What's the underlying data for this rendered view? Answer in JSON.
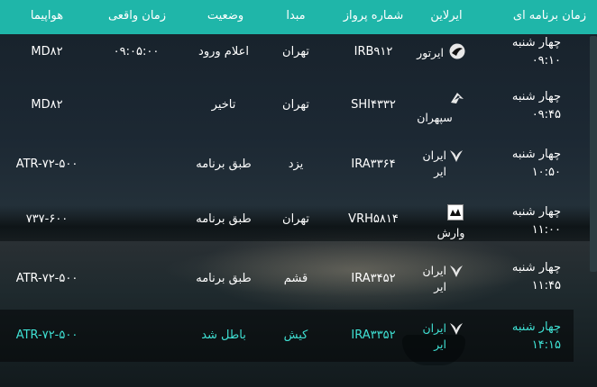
{
  "header": {
    "scheduled": "زمان برنامه ای",
    "airline": "ایرلاین",
    "flight_no": "شماره پرواز",
    "origin": "مبدا",
    "status": "وضعیت",
    "actual_time": "زمان واقعی",
    "aircraft": "هواپیما"
  },
  "flights": [
    {
      "day": "چهار شنبه",
      "time": "۰۹:۱۰",
      "airline": "ایرتور",
      "logo": "airtour-logo",
      "flight": "IRB۹۱۲",
      "origin": "تهران",
      "status": "اعلام ورود",
      "actual": "۰۹:۰۵:۰۰",
      "aircraft": "MD۸۲"
    },
    {
      "day": "چهار شنبه",
      "time": "۰۹:۴۵",
      "airline": "سپهران",
      "logo": "sepehran-logo",
      "flight": "SHI۴۳۳۲",
      "origin": "تهران",
      "status": "تاخیر",
      "actual": "",
      "aircraft": "MD۸۲"
    },
    {
      "day": "چهار شنبه",
      "time": "۱۰:۵۰",
      "airline": "ایران ایر",
      "logo": "iranair-logo",
      "flight": "IRA۳۳۶۴",
      "origin": "یزد",
      "status": "طبق برنامه",
      "actual": "",
      "aircraft": "ATR-۷۲-۵۰۰"
    },
    {
      "day": "چهار شنبه",
      "time": "۱۱:۰۰",
      "airline": "وارش",
      "logo": "varesh-logo",
      "flight": "VRH۵۸۱۴",
      "origin": "تهران",
      "status": "طبق برنامه",
      "actual": "",
      "aircraft": "۷۳۷-۶۰۰"
    },
    {
      "day": "چهار شنبه",
      "time": "۱۱:۴۵",
      "airline": "ایران ایر",
      "logo": "iranair-logo",
      "flight": "IRA۳۴۵۲",
      "origin": "قشم",
      "status": "طبق برنامه",
      "actual": "",
      "aircraft": "ATR-۷۲-۵۰۰"
    },
    {
      "day": "چهار شنبه",
      "time": "۱۴:۱۵",
      "airline": "ایران ایر",
      "logo": "iranair-logo",
      "flight": "IRA۳۳۵۲",
      "origin": "کیش",
      "status": "باطل شد",
      "actual": "",
      "aircraft": "ATR-۷۲-۵۰۰"
    }
  ],
  "colors": {
    "header_bg": "#1fb6a9",
    "cancelled_text": "#3fe0d3"
  }
}
